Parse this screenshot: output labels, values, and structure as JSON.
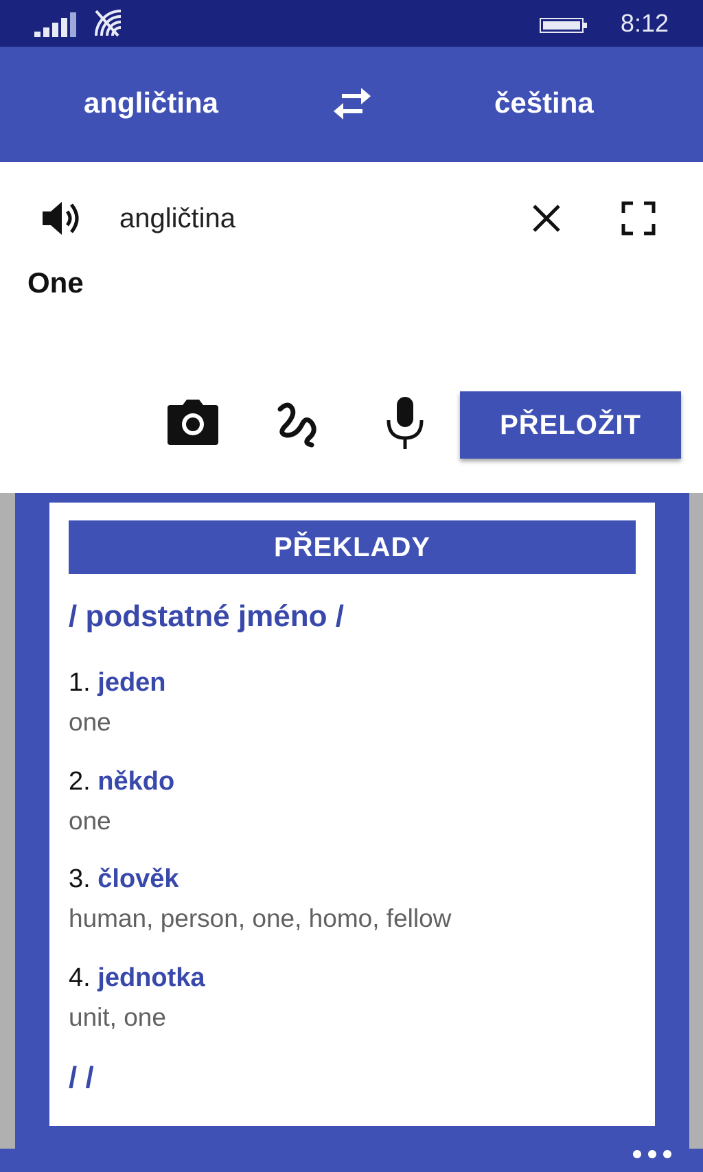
{
  "status_bar": {
    "time": "8:12",
    "icons": [
      "signal-icon",
      "wifi-icon",
      "battery-icon"
    ]
  },
  "language_bar": {
    "source_language": "angličtina",
    "target_language": "čeština",
    "swap_icon": "swap-arrows-icon"
  },
  "input": {
    "language_label": "angličtina",
    "text": "One",
    "icons": [
      "speaker-icon",
      "close-icon",
      "fullscreen-icon",
      "camera-icon",
      "handwriting-icon",
      "microphone-icon"
    ],
    "translate_button": "PŘELOŽIT"
  },
  "results": {
    "header": "PŘEKLADY",
    "part_of_speech": "/ podstatné jméno /",
    "entries": [
      {
        "number": "1.",
        "word": "jeden",
        "synonyms": "one"
      },
      {
        "number": "2.",
        "word": "někdo",
        "synonyms": "one"
      },
      {
        "number": "3.",
        "word": "člověk",
        "synonyms": "human, person, one, homo, fellow"
      },
      {
        "number": "4.",
        "word": "jednotka",
        "synonyms": "unit, one"
      }
    ],
    "end_marker": "/  /"
  },
  "bottom_bar": {
    "more_icon": "more-dots-icon"
  },
  "colors": {
    "primary": "#3f51b5",
    "status_bar": "#1a237e",
    "accent_text": "#3949ab",
    "secondary_text": "#616161"
  }
}
